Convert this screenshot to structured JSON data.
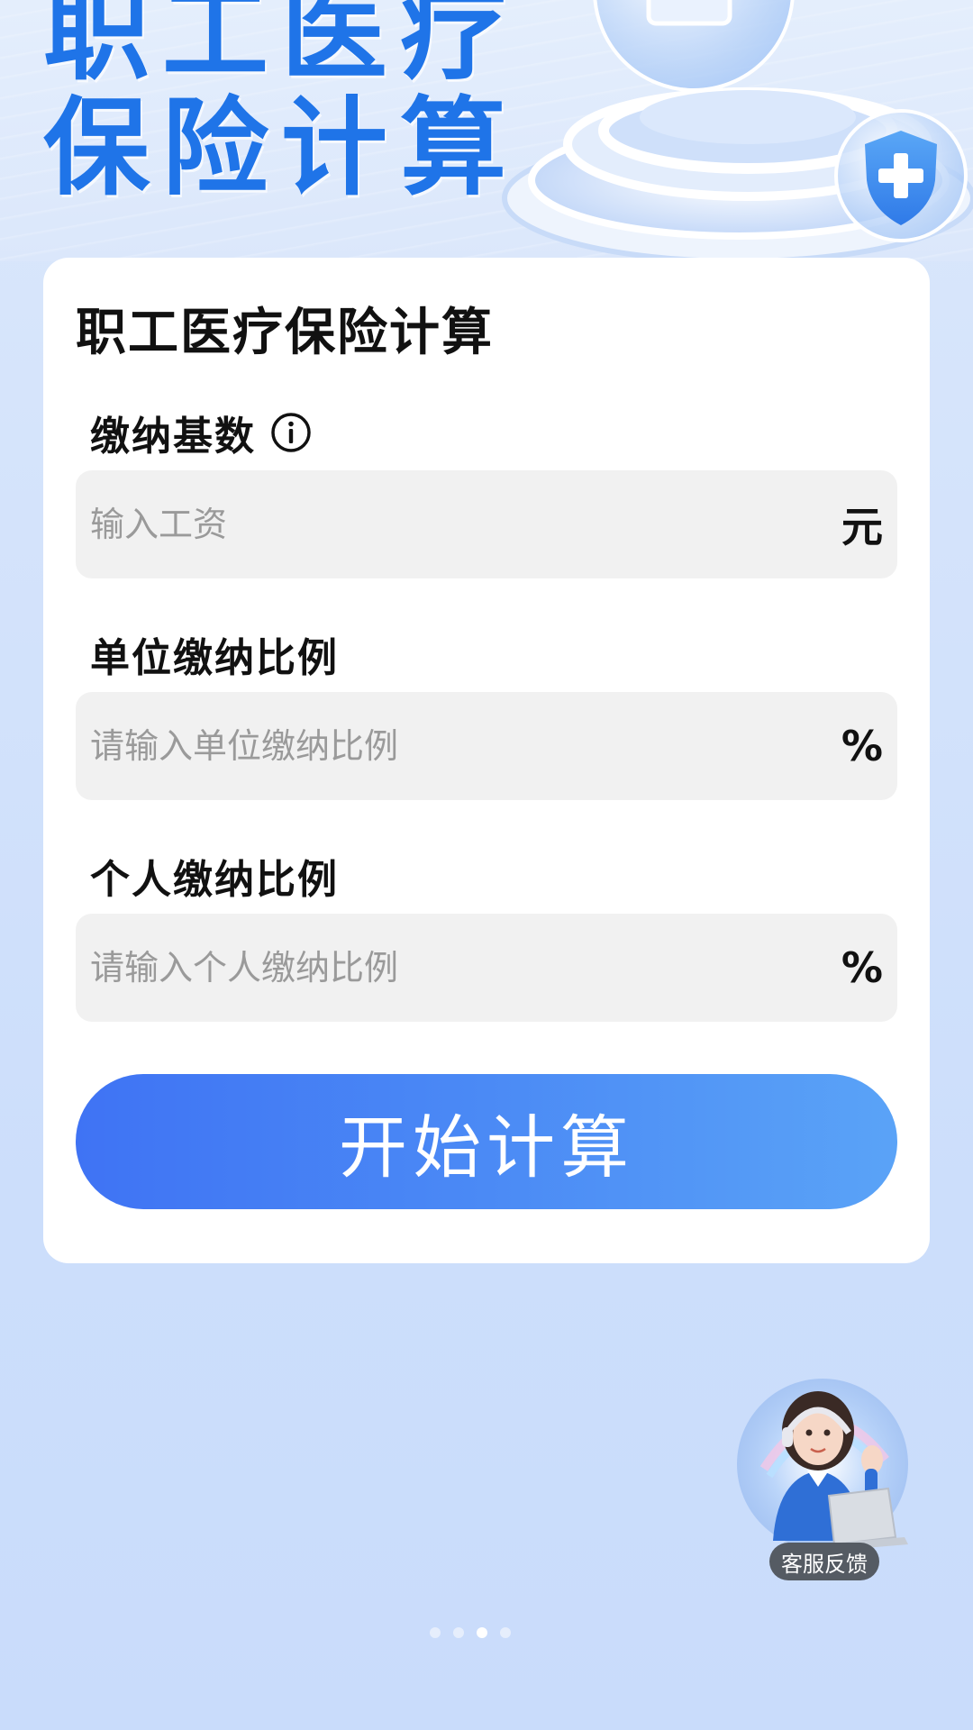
{
  "banner": {
    "title_line1": "职工医疗",
    "title_line2": "保险计算"
  },
  "card": {
    "title": "职工医疗保险计算",
    "fields": [
      {
        "label": "缴纳基数",
        "placeholder": "输入工资",
        "unit": "元",
        "has_info_icon": true
      },
      {
        "label": "单位缴纳比例",
        "placeholder": "请输入单位缴纳比例",
        "unit": "%"
      },
      {
        "label": "个人缴纳比例",
        "placeholder": "请输入个人缴纳比例",
        "unit": "%"
      }
    ],
    "calculate_button": "开始计算"
  },
  "customer_service": {
    "label": "客服反馈"
  },
  "pager": {
    "count": 4,
    "active_index": 2
  },
  "colors": {
    "brand_blue": "#1f74e8",
    "button_start": "#3f73f4",
    "button_end": "#5aa3f7",
    "page_background": "#d4e3fb",
    "field_background": "#f1f1f1"
  }
}
